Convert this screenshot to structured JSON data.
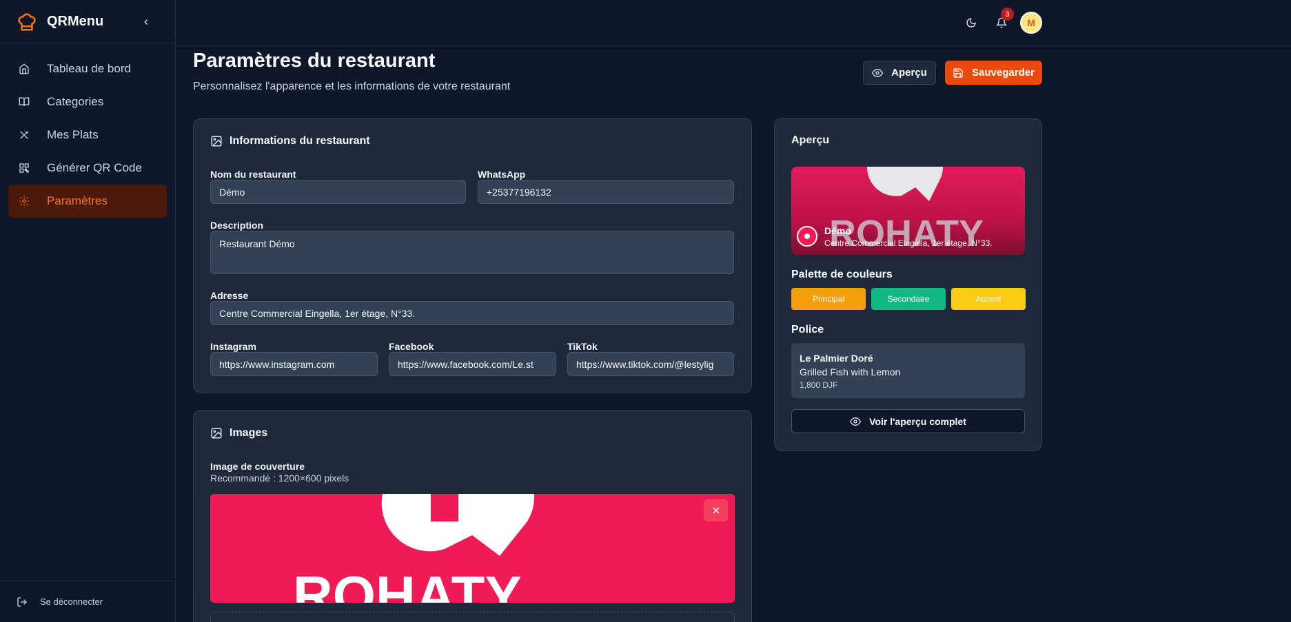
{
  "brand": {
    "name": "QRMenu"
  },
  "sidebar": {
    "items": [
      {
        "label": "Tableau de bord",
        "icon": "home-icon"
      },
      {
        "label": "Categories",
        "icon": "book-icon"
      },
      {
        "label": "Mes Plats",
        "icon": "utensils-icon"
      },
      {
        "label": "Générer QR Code",
        "icon": "qr-code-icon"
      },
      {
        "label": "Paramètres",
        "icon": "gear-icon",
        "active": true
      }
    ],
    "logout_label": "Se déconnecter"
  },
  "topbar": {
    "notification_count": "3",
    "avatar_initial": "M"
  },
  "header": {
    "title": "Paramètres du restaurant",
    "subtitle": "Personnalisez l'apparence et les informations de votre restaurant",
    "preview_label": "Aperçu",
    "save_label": "Sauvegarder"
  },
  "info_card": {
    "title": "Informations du restaurant",
    "name_label": "Nom du restaurant",
    "name_value": "Démo",
    "whatsapp_label": "WhatsApp",
    "whatsapp_value": "+25377196132",
    "description_label": "Description",
    "description_value": "Restaurant Démo",
    "address_label": "Adresse",
    "address_value": "Centre Commercial Eingella, 1er étage, N°33.",
    "instagram_label": "Instagram",
    "instagram_value": "https://www.instagram.com",
    "facebook_label": "Facebook",
    "facebook_value": "https://www.facebook.com/Le.st",
    "tiktok_label": "TikTok",
    "tiktok_value": "https://www.tiktok.com/@lestylig"
  },
  "images_card": {
    "title": "Images",
    "cover_label": "Image de couverture",
    "cover_hint": "Recommandé : 1200×600 pixels",
    "cover_brand_text": "ROHATY"
  },
  "preview_card": {
    "title": "Aperçu",
    "restaurant_name": "Démo",
    "restaurant_address": "Centre Commercial Eingella, 1er étage, N°33.",
    "banner_brand_text": "ROHATY",
    "palette_title": "Palette de couleurs",
    "palette": [
      {
        "label": "Principal",
        "color": "#f59e0b"
      },
      {
        "label": "Secondaire",
        "color": "#10b981"
      },
      {
        "label": "Accent",
        "color": "#facc15"
      }
    ],
    "font_title": "Police",
    "font_sample_name": "Le Palmier Doré",
    "font_sample_dish": "Grilled Fish with Lemon",
    "font_sample_price": "1,800 DJF",
    "full_preview_label": "Voir l'aperçu complet"
  },
  "colors": {
    "accent": "#ea4a0c",
    "brand_pink": "#ef1b55"
  }
}
